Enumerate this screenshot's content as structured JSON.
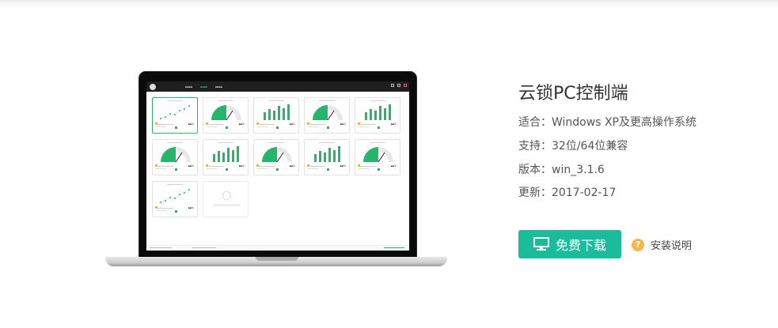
{
  "product": {
    "title": "云锁PC控制端",
    "compat_label": "适合：",
    "compat_value": "Windows XP及更高操作系统",
    "support_label": "支持：",
    "support_value": "32位/64位兼容",
    "version_label": "版本：",
    "version_value": "win_3.1.6",
    "updated_label": "更新：",
    "updated_value": "2017-02-17"
  },
  "actions": {
    "download_label": "免费下载",
    "help_label": "安装说明",
    "download_icon": "monitor-icon",
    "help_icon": "question-icon"
  },
  "colors": {
    "accent": "#1bbc9b",
    "chart_green": "#27b56b",
    "help_orange": "#f2b84b"
  },
  "screen_cards": [
    {
      "kind": "line",
      "selected": true
    },
    {
      "kind": "gauge",
      "selected": false
    },
    {
      "kind": "bars",
      "selected": false
    },
    {
      "kind": "gauge",
      "selected": false
    },
    {
      "kind": "bars",
      "selected": false
    },
    {
      "kind": "gauge",
      "selected": false
    },
    {
      "kind": "bars",
      "selected": false
    },
    {
      "kind": "gauge",
      "selected": false
    },
    {
      "kind": "bars",
      "selected": false
    },
    {
      "kind": "gauge",
      "selected": false
    },
    {
      "kind": "line",
      "selected": false
    },
    {
      "kind": "empty",
      "selected": false
    }
  ]
}
